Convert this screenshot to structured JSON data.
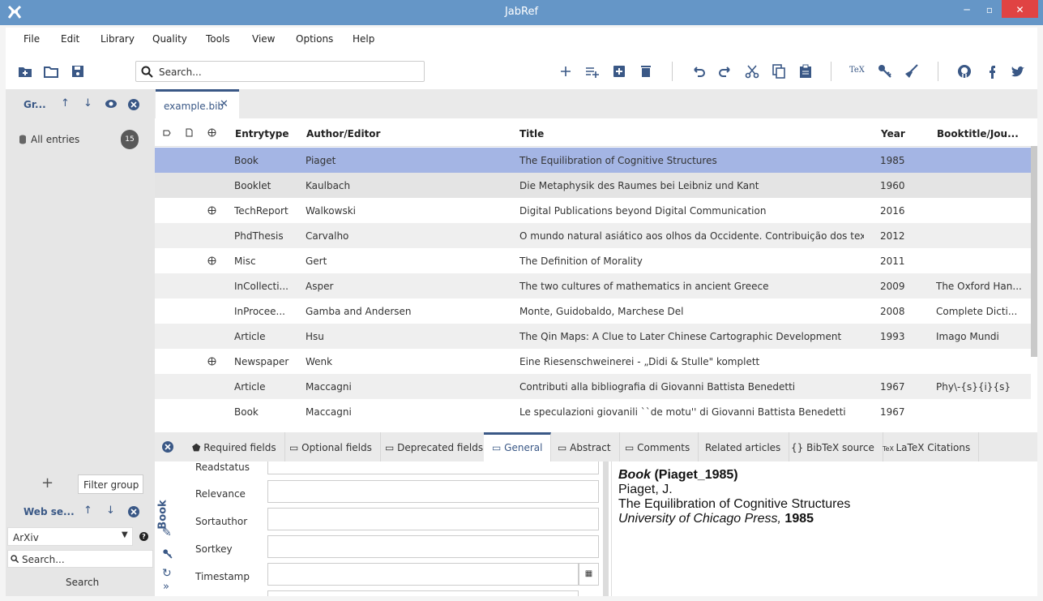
{
  "app": {
    "title": "JabRef"
  },
  "menu": [
    "File",
    "Edit",
    "Library",
    "Quality",
    "Tools",
    "View",
    "Options",
    "Help"
  ],
  "search": {
    "placeholder": "Search..."
  },
  "sidebar": {
    "groups_title": "Gr...",
    "all_entries": "All entries",
    "count": "15",
    "filter_placeholder": "Filter group",
    "web_search_title": "Web se...",
    "fetcher": "ArXiv",
    "web_search_placeholder": "Search...",
    "search_button": "Search"
  },
  "file_tab": "example.bib",
  "table": {
    "columns": [
      "Entrytype",
      "Author/Editor",
      "Title",
      "Year",
      "Booktitle/Jou..."
    ],
    "rows": [
      {
        "type": "Book",
        "author": "Piaget",
        "title": "The Equilibration of Cognitive Structures",
        "year": "1985",
        "booktitle": "",
        "link": false
      },
      {
        "type": "Booklet",
        "author": "Kaulbach",
        "title": "Die Metaphysik des Raumes bei Leibniz und Kant",
        "year": "1960",
        "booktitle": "",
        "link": false
      },
      {
        "type": "TechReport",
        "author": "Walkowski",
        "title": "Digital Publications beyond Digital Communication",
        "year": "2016",
        "booktitle": "",
        "link": true
      },
      {
        "type": "PhdThesis",
        "author": "Carvalho",
        "title": "O mundo natural asiático aos olhos da Occidente. Contribuição dos textos ib...",
        "year": "2012",
        "booktitle": "",
        "link": false
      },
      {
        "type": "Misc",
        "author": "Gert",
        "title": "The Definition of Morality",
        "year": "2011",
        "booktitle": "",
        "link": true
      },
      {
        "type": "InCollecti...",
        "author": "Asper",
        "title": "The two cultures of mathematics in ancient Greece",
        "year": "2009",
        "booktitle": "The Oxford Han...",
        "link": false
      },
      {
        "type": "InProcee...",
        "author": "Gamba and Andersen",
        "title": "Monte, Guidobaldo, Marchese Del",
        "year": "2008",
        "booktitle": "Complete Dicti...",
        "link": false
      },
      {
        "type": "Article",
        "author": "Hsu",
        "title": "The Qin Maps: A Clue to Later Chinese Cartographic Development",
        "year": "1993",
        "booktitle": "Imago Mundi",
        "link": false
      },
      {
        "type": "Newspaper",
        "author": "Wenk",
        "title": "Eine Riesenschweinerei - „Didi & Stulle\" komplett",
        "year": "",
        "booktitle": "",
        "link": true
      },
      {
        "type": "Article",
        "author": "Maccagni",
        "title": "Contributi alla bibliografia di Giovanni Battista Benedetti",
        "year": "1967",
        "booktitle": "Phy\\-{s}{i}{s}",
        "link": false
      },
      {
        "type": "Book",
        "author": "Maccagni",
        "title": "Le speculazioni giovanili ``de motu'' di Giovanni Battista Benedetti",
        "year": "1967",
        "booktitle": "",
        "link": false
      }
    ]
  },
  "editor": {
    "tabs": [
      "Required fields",
      "Optional fields",
      "Deprecated fields",
      "General",
      "Abstract",
      "Comments",
      "Related articles",
      "BibTeX source",
      "LaTeX Citations"
    ],
    "side_label": "Book",
    "fields": [
      "Readstatus",
      "Relevance",
      "Sortauthor",
      "Sortkey",
      "Timestamp"
    ]
  },
  "preview": {
    "type": "Book",
    "key": "(Piaget_1985)",
    "author": "Piaget, J.",
    "title": "The Equilibration of Cognitive Structures",
    "publisher": "University of Chicago Press,",
    "year": "1985"
  },
  "colors": {
    "titlebar": "#6596c7",
    "accent": "#3a5886",
    "selected_row": "#a4b5e4",
    "close_button": "#e04343"
  }
}
